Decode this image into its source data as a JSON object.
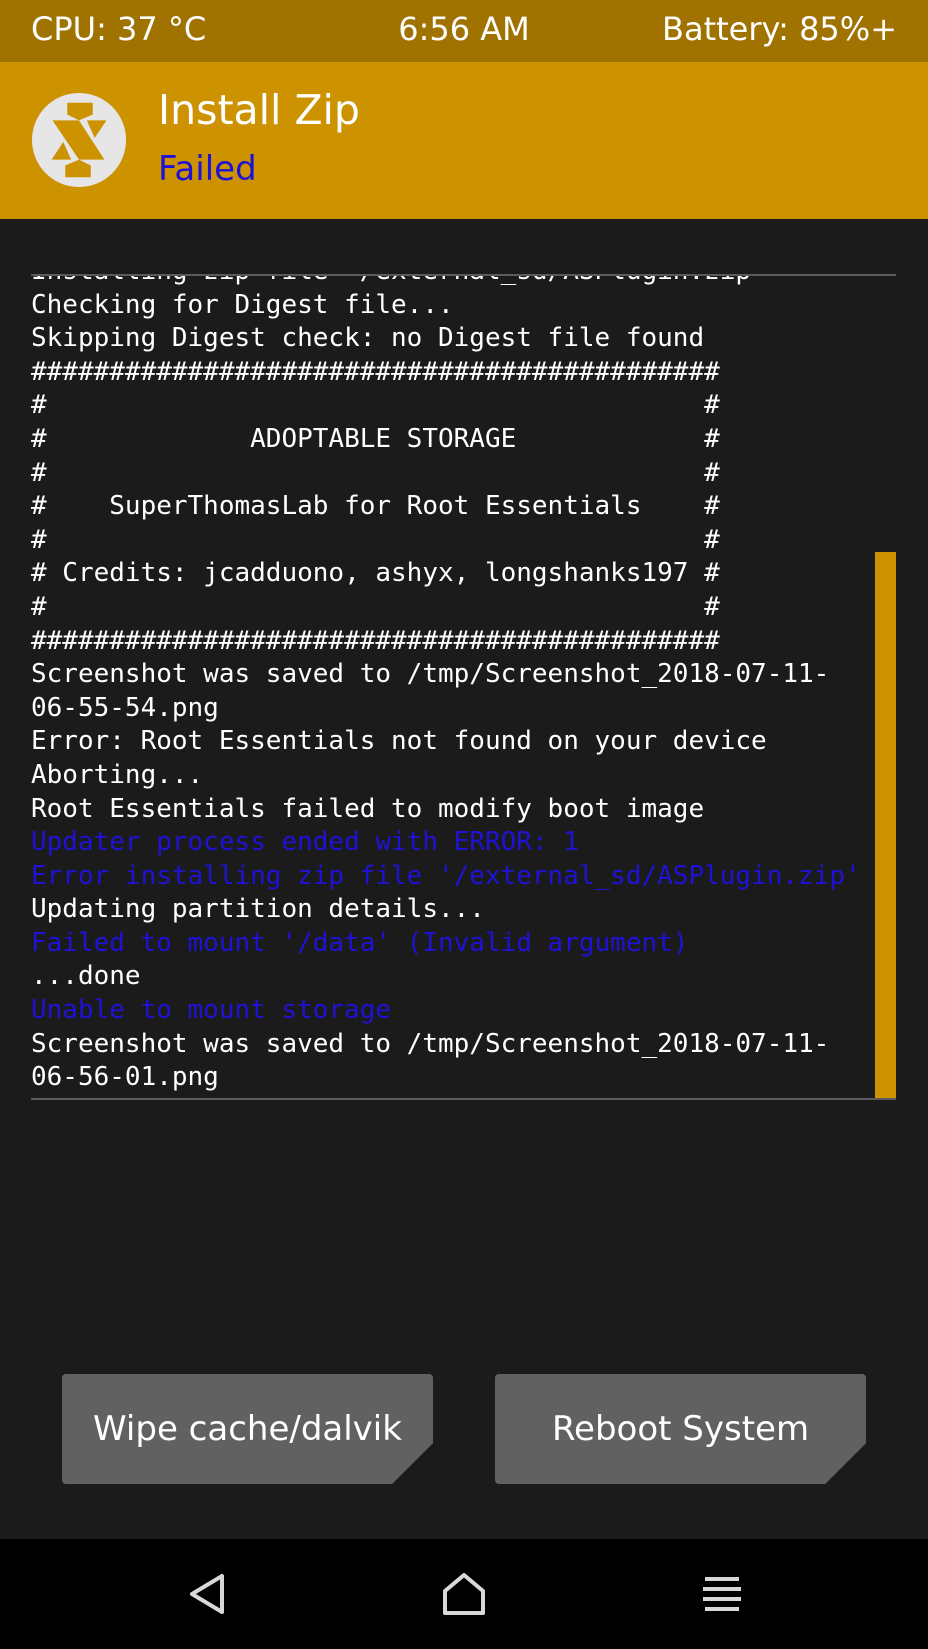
{
  "status_bar": {
    "cpu": "CPU: 37 °C",
    "time": "6:56 AM",
    "battery": "Battery: 85%+"
  },
  "header": {
    "logo_icon": "twrp-logo-icon",
    "title": "Install Zip",
    "status": "Failed"
  },
  "console": {
    "lines": [
      {
        "text": "Installing zip file '/external_sd/ASPlugin.zip'",
        "type": "normal"
      },
      {
        "text": "Checking for Digest file...",
        "type": "normal"
      },
      {
        "text": "Skipping Digest check: no Digest file found",
        "type": "normal"
      },
      {
        "text": "############################################",
        "type": "normal"
      },
      {
        "text": "#                                          #",
        "type": "normal"
      },
      {
        "text": "#             ADOPTABLE STORAGE            #",
        "type": "normal"
      },
      {
        "text": "#                                          #",
        "type": "normal"
      },
      {
        "text": "#    SuperThomasLab for Root Essentials    #",
        "type": "normal"
      },
      {
        "text": "#                                          #",
        "type": "normal"
      },
      {
        "text": "# Credits: jcadduono, ashyx, longshanks197 #",
        "type": "normal"
      },
      {
        "text": "#                                          #",
        "type": "normal"
      },
      {
        "text": "############################################",
        "type": "normal"
      },
      {
        "text": "Screenshot was saved to /tmp/Screenshot_2018-07-11-",
        "type": "normal"
      },
      {
        "text": "06-55-54.png",
        "type": "normal"
      },
      {
        "text": "Error: Root Essentials not found on your device",
        "type": "normal"
      },
      {
        "text": "Aborting...",
        "type": "normal"
      },
      {
        "text": "Root Essentials failed to modify boot image",
        "type": "normal"
      },
      {
        "text": "Updater process ended with ERROR: 1",
        "type": "error"
      },
      {
        "text": "Error installing zip file '/external_sd/ASPlugin.zip'",
        "type": "error"
      },
      {
        "text": "Updating partition details...",
        "type": "normal"
      },
      {
        "text": "Failed to mount '/data' (Invalid argument)",
        "type": "error"
      },
      {
        "text": "...done",
        "type": "normal"
      },
      {
        "text": "Unable to mount storage",
        "type": "error"
      },
      {
        "text": "Screenshot was saved to /tmp/Screenshot_2018-07-11-",
        "type": "normal"
      },
      {
        "text": "06-56-01.png",
        "type": "normal"
      }
    ]
  },
  "actions": {
    "wipe_label": "Wipe cache/dalvik",
    "reboot_label": "Reboot System"
  },
  "nav": {
    "back_icon": "back-triangle-icon",
    "home_icon": "home-icon",
    "menu_icon": "menu-icon"
  },
  "colors": {
    "status_bar": "#a07200",
    "header": "#cc9200",
    "accent_error": "#1f12d6",
    "background": "#1b1b1b",
    "button": "#616161"
  }
}
